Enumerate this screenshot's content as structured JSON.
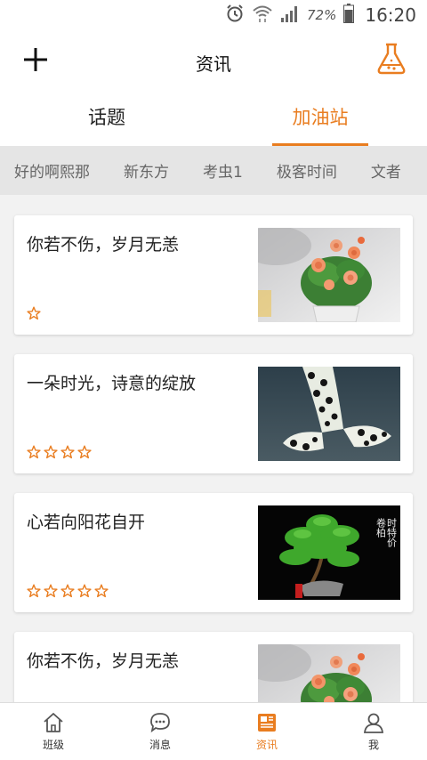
{
  "status_bar": {
    "battery_percent": "72%",
    "time": "16:20"
  },
  "header": {
    "title": "资讯"
  },
  "main_tabs": [
    {
      "label": "话题",
      "active": false
    },
    {
      "label": "加油站",
      "active": true
    }
  ],
  "categories": [
    "好的啊熙那",
    "新东方",
    "考虫1",
    "极客时间",
    "文者"
  ],
  "feed": [
    {
      "title": "你若不伤，岁月无恙",
      "stars": 1,
      "image": "rose-pot"
    },
    {
      "title": "一朵时光，诗意的绽放",
      "stars": 4,
      "image": "spotted-fish"
    },
    {
      "title": "心若向阳花自开",
      "stars": 5,
      "image": "bonsai-pine",
      "image_text": "时特价",
      "image_text2": "卷柏"
    },
    {
      "title": "你若不伤，岁月无恙",
      "stars": 0,
      "image": "rose-pot"
    }
  ],
  "bottom_nav": [
    {
      "label": "班级",
      "icon": "house-icon",
      "active": false
    },
    {
      "label": "消息",
      "icon": "chat-bubble-icon",
      "active": false
    },
    {
      "label": "资讯",
      "icon": "newspaper-icon",
      "active": true
    },
    {
      "label": "我",
      "icon": "person-icon",
      "active": false
    }
  ],
  "colors": {
    "accent": "#e97d20",
    "background": "#f2f2f2",
    "category_bar": "#e5e5e5"
  }
}
